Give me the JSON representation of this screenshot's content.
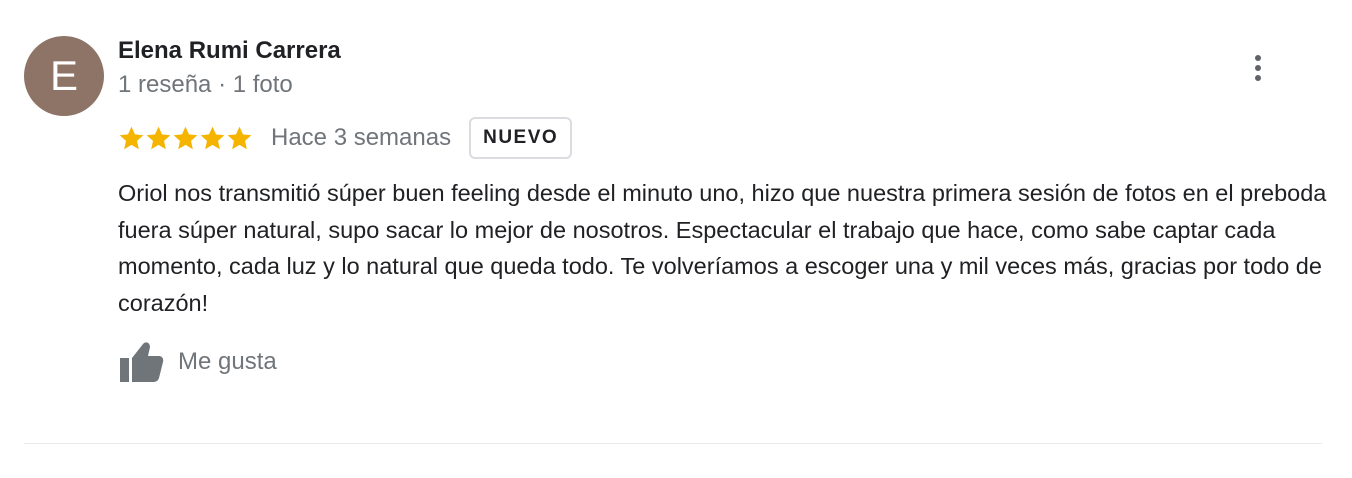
{
  "reviewer": {
    "initial": "E",
    "avatar_color": "#8d7466",
    "name": "Elena Rumi Carrera",
    "meta": "1 reseña · 1 foto"
  },
  "review": {
    "rating": 5,
    "max_rating": 5,
    "star_color": "#f4b400",
    "time_ago": "Hace 3 semanas",
    "badge": "NUEVO",
    "text": "Oriol nos transmitió súper buen feeling desde el minuto uno, hizo que nuestra primera sesión de fotos en el preboda fuera súper natural, supo sacar lo mejor de nosotros. Espectacular el trabajo que hace, como sabe captar cada momento, cada luz y lo natural que queda todo. Te volveríamos a escoger una y mil veces más, gracias por todo de corazón!"
  },
  "actions": {
    "like_label": "Me gusta",
    "like_icon": "thumb-up-icon",
    "menu_icon": "more-vert-icon"
  }
}
